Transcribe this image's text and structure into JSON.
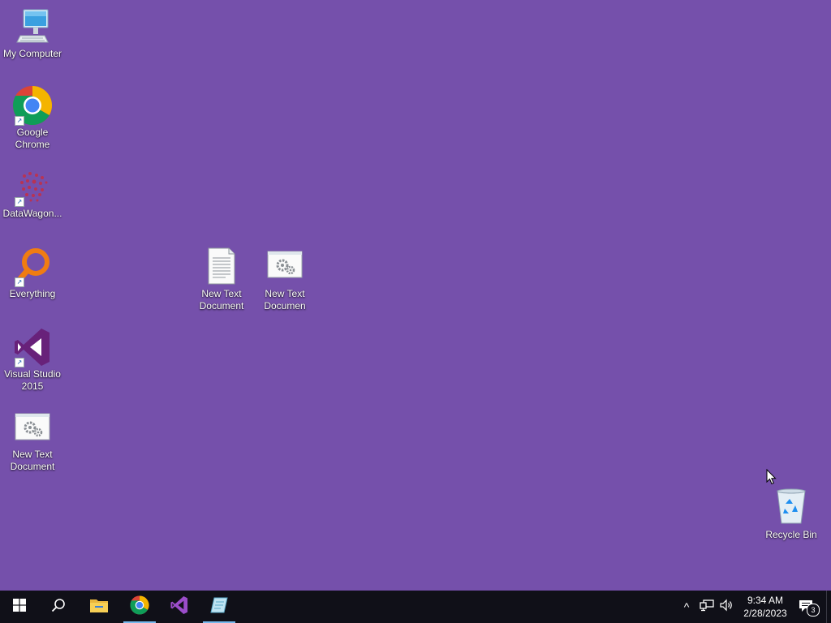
{
  "desktop": {
    "background_color": "#7550ab",
    "icons": [
      {
        "label": "My Computer",
        "icon": "computer-icon"
      },
      {
        "label": "Google Chrome",
        "icon": "chrome-icon",
        "shortcut": true
      },
      {
        "label": "DataWagon...",
        "icon": "datawagon-icon",
        "shortcut": true
      },
      {
        "label": "Everything",
        "icon": "everything-search-icon",
        "shortcut": true
      },
      {
        "label": "Visual Studio 2015",
        "icon": "visual-studio-icon",
        "shortcut": true
      },
      {
        "label": "New Text Document",
        "icon": "executable-gear-icon"
      },
      {
        "label": "New Text Document",
        "icon": "text-file-icon"
      },
      {
        "label": "New Text Documen",
        "icon": "executable-gear-icon"
      },
      {
        "label": "Recycle Bin",
        "icon": "recycle-bin-icon"
      }
    ]
  },
  "taskbar": {
    "start_icon": "windows-logo-icon",
    "search_icon": "search-icon",
    "pinned": [
      {
        "name": "File Explorer",
        "icon": "folder-icon",
        "active": false
      },
      {
        "name": "Google Chrome",
        "icon": "chrome-icon",
        "active": true
      },
      {
        "name": "Visual Studio 2015",
        "icon": "visual-studio-icon",
        "active": false
      },
      {
        "name": "App",
        "icon": "app-icon",
        "active": true
      }
    ],
    "tray": {
      "chevron": "^",
      "network_icon": "network-icon",
      "volume_icon": "volume-icon",
      "time": "9:34 AM",
      "date": "2/28/2023",
      "notification_count": "3"
    }
  }
}
